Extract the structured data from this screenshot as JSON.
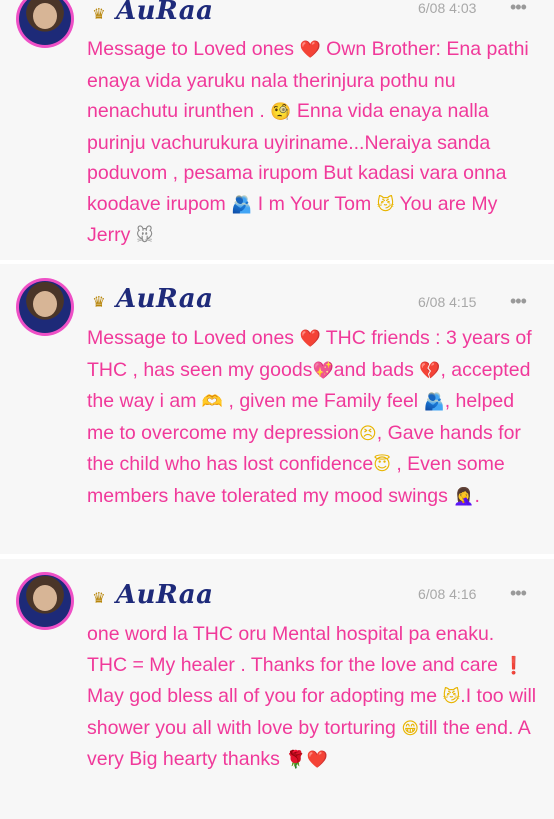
{
  "posts": [
    {
      "author": "AuRaa",
      "time": "6/08 4:03",
      "more_label": "•••",
      "message": {
        "p1": "Message to Loved ones ",
        "e1": "❤️",
        "p2": " Own Brother: Ena pathi enaya vida yaruku nala therinjura pothu nu nenachutu irunthen . ",
        "e2": "🧐",
        "p3": " Enna vida enaya nalla purinju vachurukura uyiriname...Neraiya sanda poduvom , pesama irupom But kadasi vara onna koodave irupom ",
        "e3": "🫂",
        "p4": " I m Your Tom ",
        "e4": "😼",
        "p5": " You are My Jerry ",
        "e5": "🐭"
      }
    },
    {
      "author": "AuRaa",
      "time": "6/08 4:15",
      "more_label": "•••",
      "message": {
        "p1": "Message to Loved ones ",
        "e1": "❤️",
        "p2": " THC friends : 3 years of THC , has seen my goods",
        "e2": "💖",
        "p3": "and bads ",
        "e3": "💔",
        "p4": ", accepted the way i am ",
        "e4": "🫶",
        "p5": " , given me Family feel ",
        "e5": "🫂",
        "p6": ", helped me to overcome my depression",
        "e6": "😣",
        "p7": ", Gave hands for the child who has lost confidence",
        "e7": "😇",
        "p8": " , Even some members have tolerated my mood swings ",
        "e8": "🤦‍♀️",
        "p9": "."
      }
    },
    {
      "author": "AuRaa",
      "time": "6/08 4:16",
      "more_label": "•••",
      "message": {
        "p1": "one word la THC oru Mental hospital pa enaku. THC = My healer . Thanks for the love and care ",
        "e1": "❗",
        "p2": " May god bless all of you for adopting me ",
        "e2": "😼",
        "p3": ".I too will shower you all with love by torturing ",
        "e3": "😁",
        "p4": "till the end. A very Big hearty thanks ",
        "e4": "🌹",
        "e5": "❤️"
      }
    }
  ],
  "crown_icon": "♛"
}
